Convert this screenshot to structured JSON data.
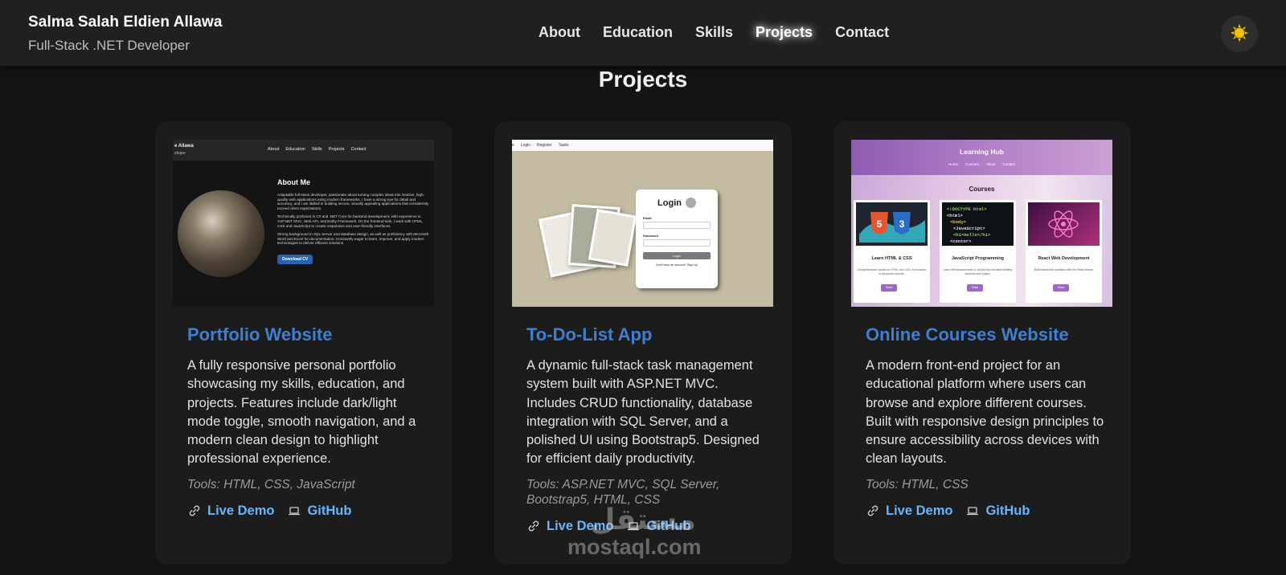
{
  "header": {
    "name": "Salma Salah Eldien Allawa",
    "role": "Full-Stack .NET Developer",
    "nav": [
      {
        "label": "About",
        "active": false
      },
      {
        "label": "Education",
        "active": false
      },
      {
        "label": "Skills",
        "active": false
      },
      {
        "label": "Projects",
        "active": true
      },
      {
        "label": "Contact",
        "active": false
      }
    ],
    "theme_toggle_icon": "sun-icon"
  },
  "section": {
    "title": "Projects"
  },
  "projects": [
    {
      "title": "Portfolio Website",
      "description": "A fully responsive personal portfolio showcasing my skills, education, and projects. Features include dark/light mode toggle, smooth navigation, and a modern clean design to highlight professional experience.",
      "tools": "Tools: HTML, CSS, JavaScript",
      "live_demo": "Live Demo",
      "github": "GitHub",
      "thumb": {
        "name": "e Allawa",
        "role": "eloper",
        "nav": [
          "About",
          "Education",
          "Skills",
          "Projects",
          "Contact"
        ],
        "heading": "About Me",
        "p1": "Adaptable full-stack developer, passionate about turning complex ideas into intuitive, high-quality web applications using modern frameworks. I have a strong eye for detail and accuracy, and I am skilled in building secure, visually appealing applications that consistently exceed client expectations.",
        "p2": "Technically proficient in C# and .NET Core for backend development, with experience in ASP.NET MVC, Web API, and Entity Framework. On the frontend side, I work with HTML, CSS and JavaScript to create responsive and user-friendly interfaces.",
        "p3": "Strong background in SQL Server and database design, as well as proficiency with Microsoft Word and Excel for documentation. Constantly eager to learn, improve, and apply modern technologies to deliver efficient solutions.",
        "button": "Download CV"
      }
    },
    {
      "title": "To-Do-List App",
      "description": "A dynamic full-stack task management system built with ASP.NET MVC. Includes CRUD functionality, database integration with SQL Server, and a polished UI using Bootstrap5. Designed for efficient daily productivity.",
      "tools": "Tools: ASP.NET MVC, SQL Server, Bootstrap5, HTML, CSS",
      "live_demo": "Live Demo",
      "github": "GitHub",
      "thumb": {
        "nav": [
          "e",
          "Login",
          "Register",
          "Tasks"
        ],
        "heading": "Login",
        "email_label": "Email",
        "password_label": "Password",
        "button": "Login",
        "footer": "Don't have an account? Sign Up"
      }
    },
    {
      "title": "Online Courses Website",
      "description": "A modern front-end project for an educational platform where users can browse and explore different courses. Built with responsive design principles to ensure accessibility across devices with clean layouts.",
      "tools": "Tools: HTML, CSS",
      "live_demo": "Live Demo",
      "github": "GitHub",
      "thumb": {
        "site": "Learning Hub",
        "nav": [
          "Home",
          "Courses",
          "About",
          "Contact"
        ],
        "heading": "Courses",
        "courses": [
          {
            "name": "Learn HTML & CSS",
            "desc": "Comprehensive course on HTML and CSS, from basics to advanced layouts.",
            "button": "Start"
          },
          {
            "name": "JavaScript Programming",
            "desc": "Learn the fundamentals of JavaScript and start building dynamic web pages.",
            "button": "Start"
          },
          {
            "name": "React Web Development",
            "desc": "Build interactive websites with the React library.",
            "button": "Start"
          }
        ]
      }
    }
  ],
  "watermark": {
    "arabic": "مستقل",
    "latin": "mostaql.com"
  }
}
